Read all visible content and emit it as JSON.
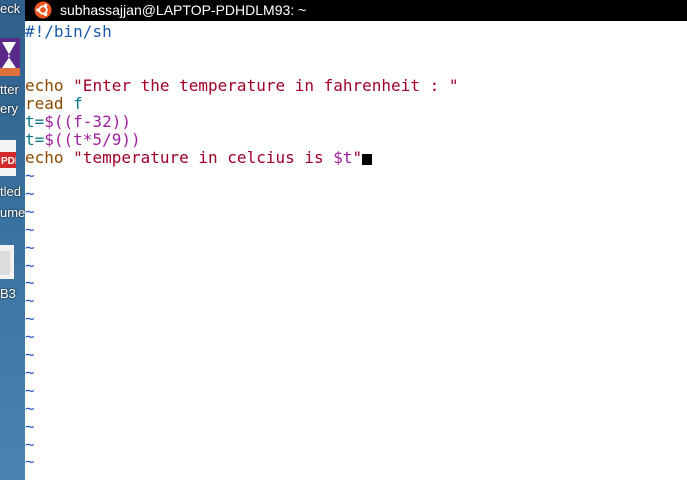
{
  "desktop": {
    "label_top": "eck",
    "label_app_1": "tter",
    "label_app_2": "ery",
    "label_file_1": "tled",
    "label_file_2": "ume",
    "label_db": "B3",
    "pdf_badge": "PDF"
  },
  "window": {
    "title": "subhassajjan@LAPTOP-PDHDLM93: ~"
  },
  "editor": {
    "shebang": "#!/bin/sh",
    "line_echo1_cmd": "echo ",
    "line_echo1_str": "\"Enter the temperature in fahrenheit : \"",
    "line_read_cmd": "read ",
    "line_read_var": "f",
    "line_t1_prefix": "t=",
    "line_t1_expr": "$((f-32))",
    "line_t2_prefix": "t=",
    "line_t2_expr": "$((t*5/9))",
    "line_echo2_cmd": "echo ",
    "line_echo2_str": "\"temperature in celcius is ",
    "line_echo2_var": "$t",
    "line_echo2_end": "\"",
    "tilde": "~"
  }
}
